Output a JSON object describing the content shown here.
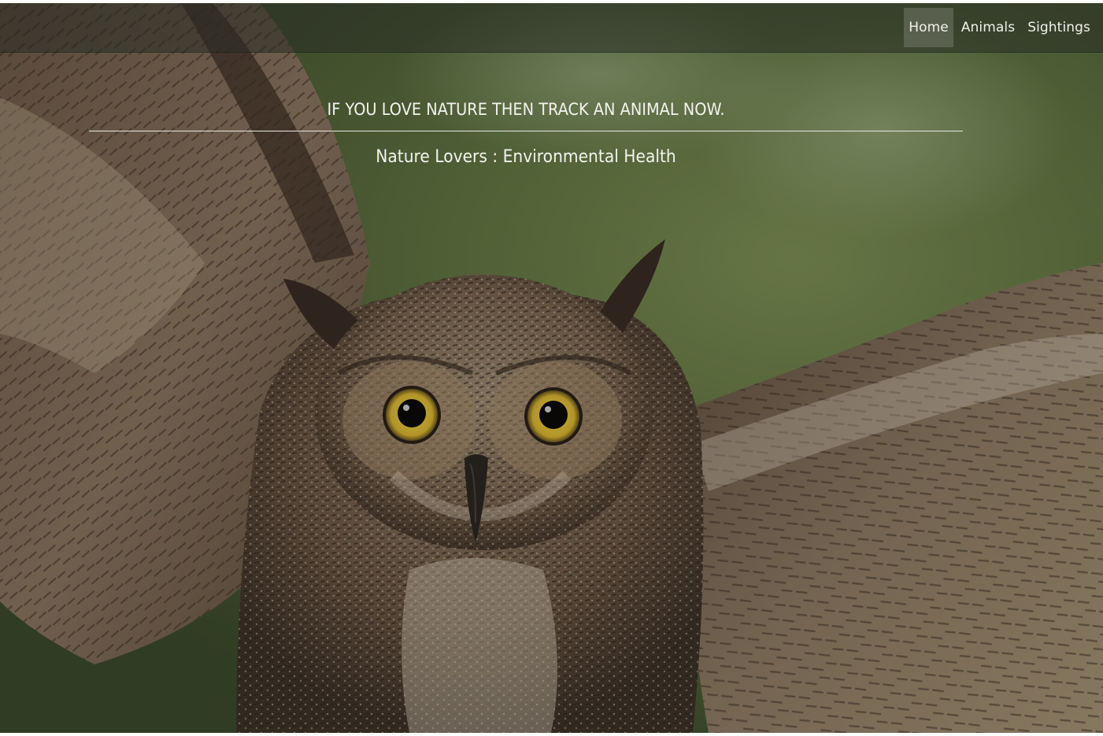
{
  "nav": {
    "items": [
      {
        "label": "Home",
        "active": true
      },
      {
        "label": "Animals",
        "active": false
      },
      {
        "label": "Sightings",
        "active": false
      }
    ]
  },
  "hero": {
    "tagline": "IF YOU LOVE NATURE THEN TRACK AN ANIMAL NOW.",
    "subtitle": "Nature Lovers : Environmental Health",
    "background_subject": "owl-photo"
  },
  "colors": {
    "text": "#f3f3ee",
    "nav_overlay": "#2a2c24",
    "active_tab": "#8c8c84",
    "foliage": "#6a8044",
    "owl_eye": "#e0c23a"
  }
}
